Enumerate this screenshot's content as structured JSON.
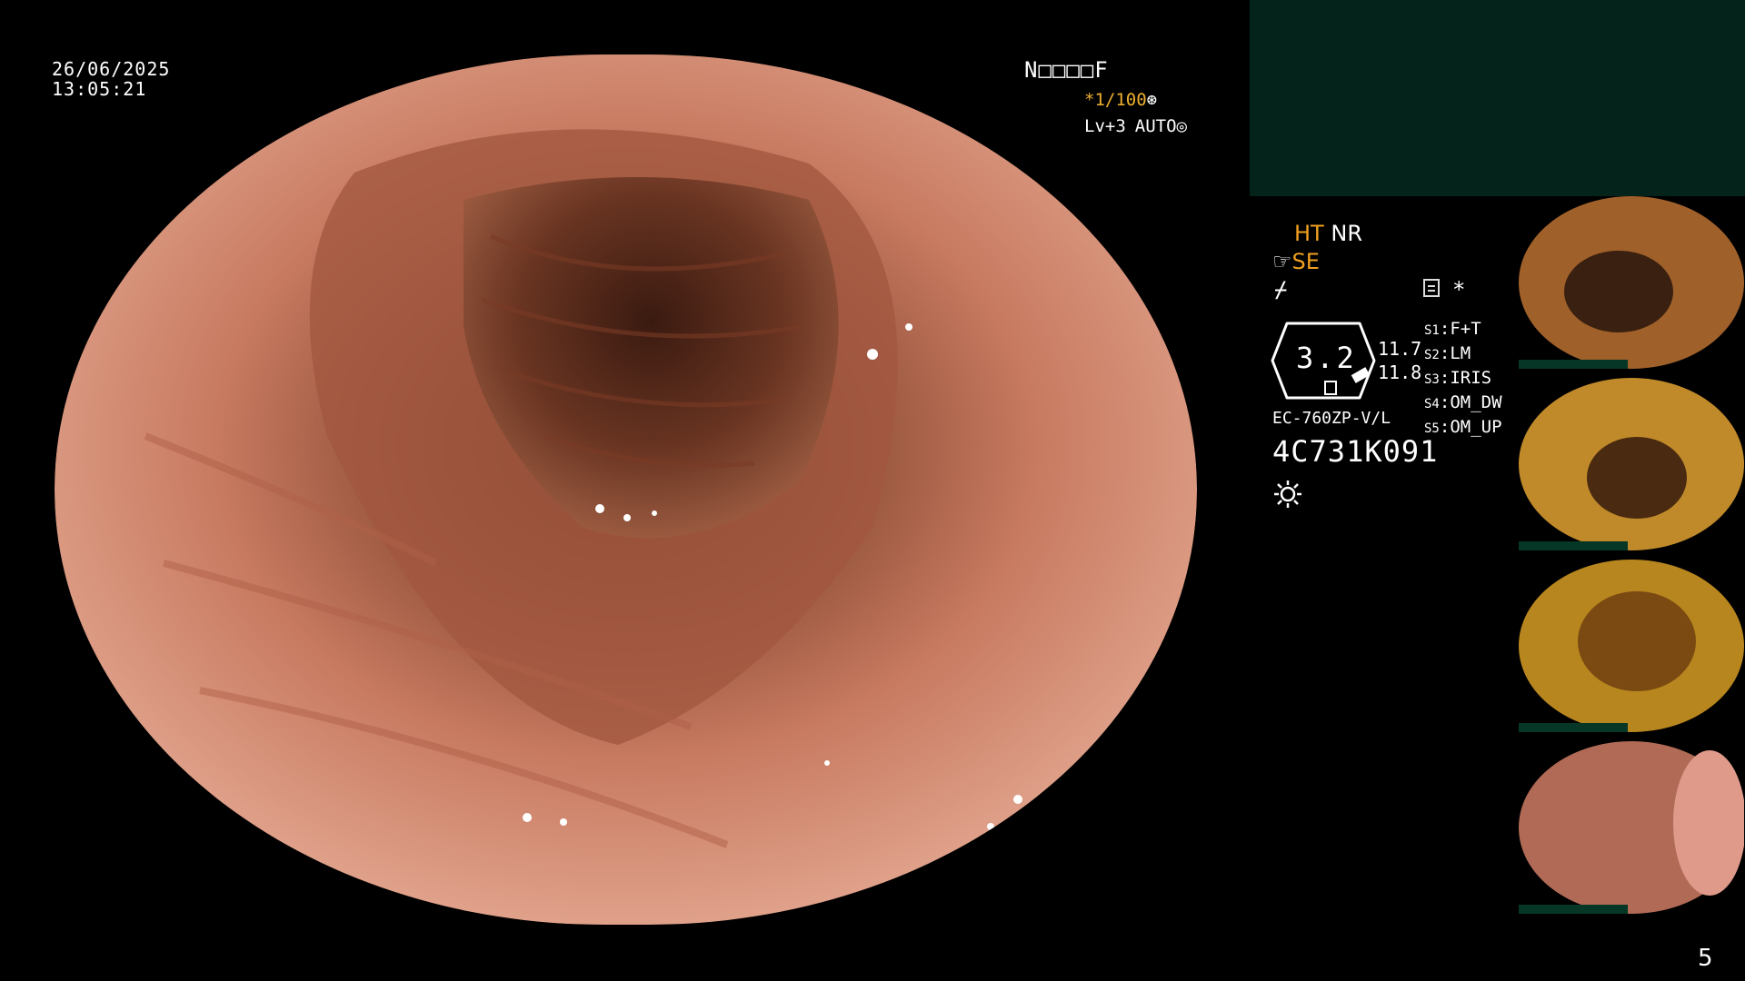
{
  "overlay": {
    "date": "26/06/2025",
    "time": "13:05:21",
    "code": "N□□□□F",
    "shutter": "*1/100",
    "level": "Lv+3",
    "auto": "AUTO"
  },
  "panel": {
    "ht": "HT",
    "nr": "NR",
    "se": "SE",
    "scope_value": "3.2",
    "num_a": "11.7",
    "num_b": "11.8",
    "model": "EC-760ZP-V/L",
    "serial": "4C731K091",
    "settings": [
      {
        "key": "S1",
        "value": "F+T"
      },
      {
        "key": "S2",
        "value": "LM"
      },
      {
        "key": "S3",
        "value": "IRIS"
      },
      {
        "key": "S4",
        "value": "OM_DW"
      },
      {
        "key": "S5",
        "value": "OM_UP"
      }
    ]
  },
  "thumbnails": [
    {
      "name": "thumb-1",
      "tone": "#a0602a"
    },
    {
      "name": "thumb-2",
      "tone": "#c08a2a"
    },
    {
      "name": "thumb-3",
      "tone": "#b8861e"
    },
    {
      "name": "thumb-4",
      "tone": "#b06a55"
    }
  ],
  "page_number": "5",
  "colors": {
    "panel_dark": "#04231b",
    "accent_orange": "#f0a020",
    "mucosa": "#c77a60"
  }
}
